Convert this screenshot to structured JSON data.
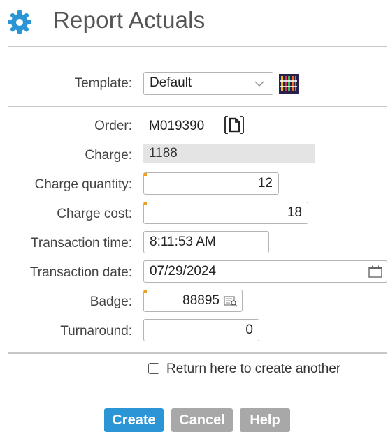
{
  "header": {
    "title": "Report Actuals",
    "icon": "gear-icon",
    "icon_color": "#2b95d6"
  },
  "template": {
    "label": "Template:",
    "value": "Default"
  },
  "form": {
    "order": {
      "label": "Order:",
      "value": "M019390"
    },
    "charge": {
      "label": "Charge:",
      "value": "1188"
    },
    "charge_quantity": {
      "label": "Charge quantity:",
      "value": "12"
    },
    "charge_cost": {
      "label": "Charge cost:",
      "value": "18"
    },
    "transaction_time": {
      "label": "Transaction time:",
      "value": "8:11:53 AM"
    },
    "transaction_date": {
      "label": "Transaction date:",
      "value": "07/29/2024"
    },
    "badge": {
      "label": "Badge:",
      "value": "88895"
    },
    "turnaround": {
      "label": "Turnaround:",
      "value": "0"
    }
  },
  "return_checkbox": {
    "label": "Return here to create another",
    "checked": false
  },
  "buttons": {
    "create": "Create",
    "cancel": "Cancel",
    "help": "Help"
  },
  "colors": {
    "accent": "#2b95d6",
    "secondary_button": "#a8a8a8",
    "required_marker": "#f0a020",
    "readonly_bg": "#e4e4e4"
  }
}
